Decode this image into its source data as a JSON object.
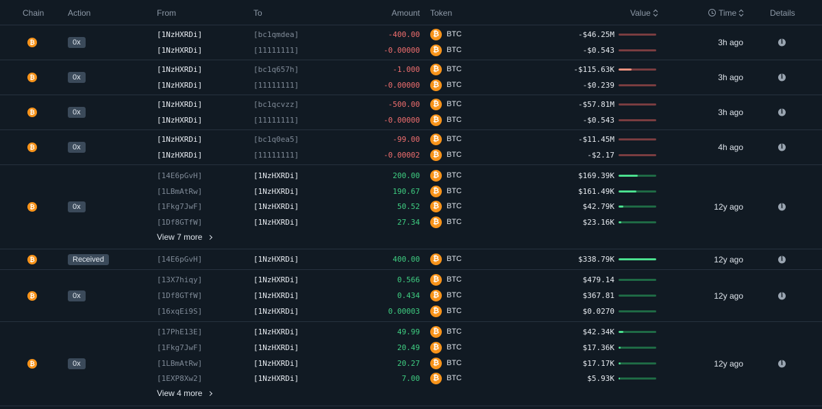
{
  "header": {
    "chain": "Chain",
    "action": "Action",
    "from": "From",
    "to": "To",
    "amount": "Amount",
    "token": "Token",
    "value": "Value",
    "time": "Time",
    "details": "Details"
  },
  "colors": {
    "btc": "#f7931a",
    "negative": "#f26f6f",
    "positive": "#3fcf82",
    "background": "#111a23"
  },
  "groups": [
    {
      "action": "0x",
      "time": "3h ago",
      "rows": [
        {
          "from": "[1NzHXRDi]",
          "to": "[bc1qmdea]",
          "amount": "-400.00",
          "token": "BTC",
          "value": "-$46.25M",
          "bar": 0.0
        },
        {
          "from": "[1NzHXRDi]",
          "to": "[11111111]",
          "amount": "-0.00000",
          "token": "BTC",
          "value": "-$0.543",
          "bar": 0.0
        }
      ]
    },
    {
      "action": "0x",
      "time": "3h ago",
      "rows": [
        {
          "from": "[1NzHXRDi]",
          "to": "[bc1q657h]",
          "amount": "-1.000",
          "token": "BTC",
          "value": "-$115.63K",
          "bar": 0.35
        },
        {
          "from": "[1NzHXRDi]",
          "to": "[11111111]",
          "amount": "-0.00000",
          "token": "BTC",
          "value": "-$0.239",
          "bar": 0.0
        }
      ]
    },
    {
      "action": "0x",
      "time": "3h ago",
      "rows": [
        {
          "from": "[1NzHXRDi]",
          "to": "[bc1qcvzz]",
          "amount": "-500.00",
          "token": "BTC",
          "value": "-$57.81M",
          "bar": 0.0
        },
        {
          "from": "[1NzHXRDi]",
          "to": "[11111111]",
          "amount": "-0.00000",
          "token": "BTC",
          "value": "-$0.543",
          "bar": 0.0
        }
      ]
    },
    {
      "action": "0x",
      "time": "4h ago",
      "rows": [
        {
          "from": "[1NzHXRDi]",
          "to": "[bc1q0ea5]",
          "amount": "-99.00",
          "token": "BTC",
          "value": "-$11.45M",
          "bar": 0.0
        },
        {
          "from": "[1NzHXRDi]",
          "to": "[11111111]",
          "amount": "-0.00002",
          "token": "BTC",
          "value": "-$2.17",
          "bar": 0.0
        }
      ]
    },
    {
      "action": "0x",
      "time": "12y ago",
      "view_more": "View 7 more",
      "rows": [
        {
          "from": "[14E6pGvH]",
          "to": "[1NzHXRDi]",
          "amount": "200.00",
          "token": "BTC",
          "value": "$169.39K",
          "bar": 0.5
        },
        {
          "from": "[1LBmAtRw]",
          "to": "[1NzHXRDi]",
          "amount": "190.67",
          "token": "BTC",
          "value": "$161.49K",
          "bar": 0.48
        },
        {
          "from": "[1Fkg7JwF]",
          "to": "[1NzHXRDi]",
          "amount": "50.52",
          "token": "BTC",
          "value": "$42.79K",
          "bar": 0.12
        },
        {
          "from": "[1Df8GTfW]",
          "to": "[1NzHXRDi]",
          "amount": "27.34",
          "token": "BTC",
          "value": "$23.16K",
          "bar": 0.07
        }
      ]
    },
    {
      "action": "Received",
      "time": "12y ago",
      "rows": [
        {
          "from": "[14E6pGvH]",
          "to": "[1NzHXRDi]",
          "amount": "400.00",
          "token": "BTC",
          "value": "$338.79K",
          "bar": 1.0
        }
      ]
    },
    {
      "action": "0x",
      "time": "12y ago",
      "rows": [
        {
          "from": "[13X7hiqy]",
          "to": "[1NzHXRDi]",
          "amount": "0.566",
          "token": "BTC",
          "value": "$479.14",
          "bar": 0.0
        },
        {
          "from": "[1Df8GTfW]",
          "to": "[1NzHXRDi]",
          "amount": "0.434",
          "token": "BTC",
          "value": "$367.81",
          "bar": 0.0
        },
        {
          "from": "[16xqEi9S]",
          "to": "[1NzHXRDi]",
          "amount": "0.00003",
          "token": "BTC",
          "value": "$0.0270",
          "bar": 0.0
        }
      ]
    },
    {
      "action": "0x",
      "time": "12y ago",
      "view_more": "View 4 more",
      "rows": [
        {
          "from": "[17PhE13E]",
          "to": "[1NzHXRDi]",
          "amount": "49.99",
          "token": "BTC",
          "value": "$42.34K",
          "bar": 0.12
        },
        {
          "from": "[1Fkg7JwF]",
          "to": "[1NzHXRDi]",
          "amount": "20.49",
          "token": "BTC",
          "value": "$17.36K",
          "bar": 0.05
        },
        {
          "from": "[1LBmAtRw]",
          "to": "[1NzHXRDi]",
          "amount": "20.27",
          "token": "BTC",
          "value": "$17.17K",
          "bar": 0.05
        },
        {
          "from": "[1EXP8Xw2]",
          "to": "[1NzHXRDi]",
          "amount": "7.00",
          "token": "BTC",
          "value": "$5.93K",
          "bar": 0.03
        }
      ]
    }
  ]
}
